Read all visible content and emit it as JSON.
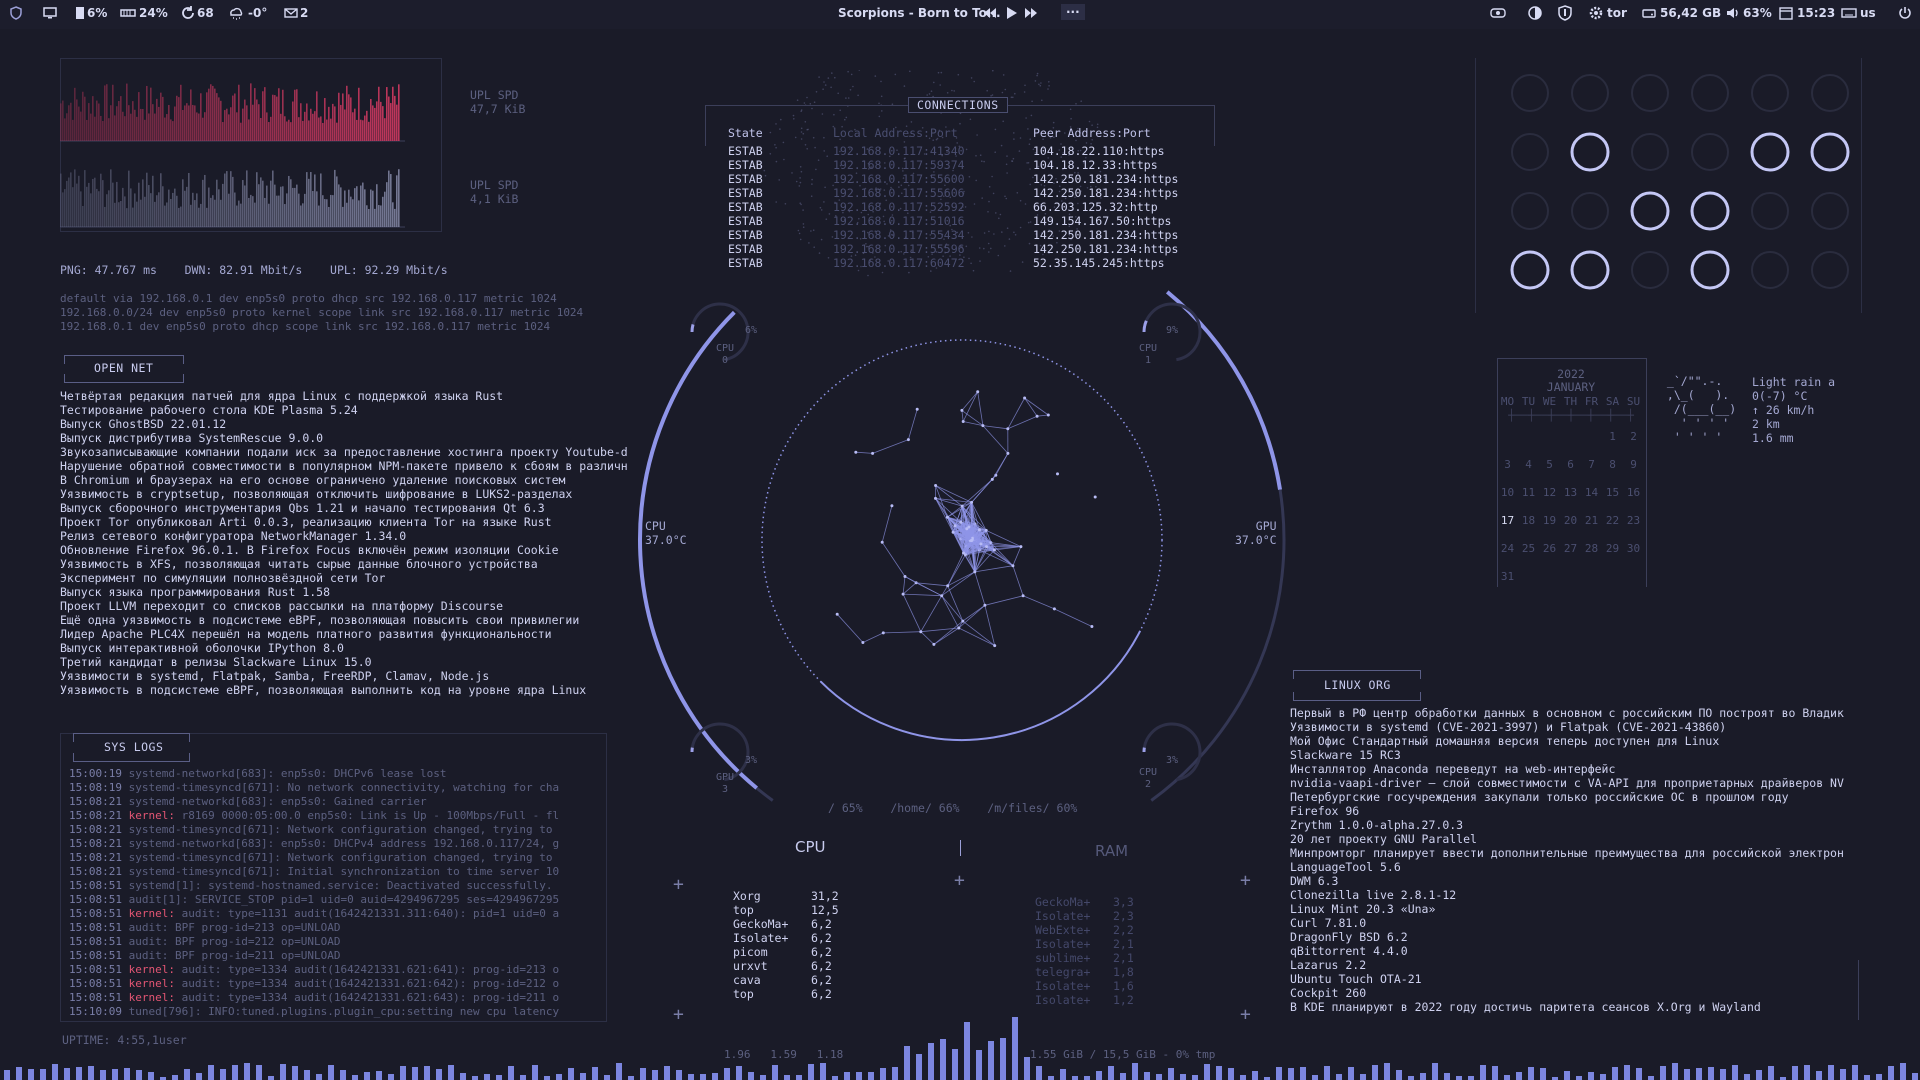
{
  "topbar": {
    "cpu": "6%",
    "mem": "24%",
    "updates": "68",
    "weather": "-0°",
    "mail": "2",
    "track": "Scorpions - Born to To...",
    "more": "···",
    "tor": "tor",
    "disk": "56,42 GB",
    "volume": "63%",
    "time": "15:23",
    "lang": "us"
  },
  "network": {
    "upl_label": "UPL SPD",
    "upl_value": "47,7 KiB",
    "dwn_label": "UPL SPD",
    "dwn_value": "4,1 KiB",
    "stats": "PNG: 47.767 ms    DWN: 82.91 Mbit/s    UPL: 92.29 Mbit/s",
    "routes": [
      "default via 192.168.0.1 dev enp5s0 proto dhcp src 192.168.0.117 metric 1024",
      "192.168.0.0/24 dev enp5s0 proto kernel scope link src 192.168.0.117 metric 1024",
      "192.168.0.1 dev enp5s0 proto dhcp scope link src 192.168.0.117 metric 1024"
    ]
  },
  "opennet": {
    "title": "OPEN NET",
    "items": [
      "Четвёртая редакция патчей для ядра Linux с поддержкой языка Rust",
      "Тестирование рабочего стола KDE Plasma 5.24",
      "Выпуск GhostBSD 22.01.12",
      "Выпуск дистрибутива SystemRescue 9.0.0",
      "Звукозаписывающие компании подали иск за предоставление хостинга проекту Youtube-d",
      "Нарушение обратной совместимости в популярном NPM-пакете привело к сбоям в различн",
      "В Chromium и браузерах на его основе ограничено удаление поисковых систем",
      "Уязвимость в cryptsetup, позволяющая отключить шифрование в LUKS2-разделах",
      "Выпуск сборочного инструментария Qbs 1.21 и начало тестирования Qt 6.3",
      "Проект Tor опубликовал Arti 0.0.3, реализацию клиента Tor на языке Rust",
      "Релиз сетевого конфигуратора NetworkManager 1.34.0",
      "Обновление Firefox 96.0.1. В Firefox Focus включён режим изоляции Cookie",
      "Уязвимость в XFS, позволяющая читать сырые данные  блочного устройства",
      "Эксперимент по симуляции полнозвёздной сети Tor",
      "Выпуск языка программирования Rust 1.58",
      "Проект LLVM переходит со списков рассылки на платформу Discourse",
      "Ещё одна уязвимость в подсистеме eBPF, позволяющая повысить свои привилегии",
      "Лидер Apache PLC4X перешёл на модель платного развития функциональности",
      "Выпуск интерактивной оболочки IPython 8.0",
      "Третий кандидат в релизы Slackware Linux 15.0",
      "Уязвимости в  systemd, Flatpak, Samba, FreeRDP, Clamav, Node.js",
      "Уязвимость в подсистеме eBPF, позволяющая выполнить код на уровне ядра Linux"
    ]
  },
  "syslogs": {
    "title": "SYS LOGS",
    "rows": [
      {
        "t": "15:00:19",
        "src": "systemd-networkd[683]:",
        "msg": " enp5s0: DHCPv6 lease lost",
        "k": false
      },
      {
        "t": "15:08:19",
        "src": "systemd-timesyncd[671]:",
        "msg": " No network connectivity, watching for cha",
        "k": false
      },
      {
        "t": "15:08:21",
        "src": "systemd-networkd[683]:",
        "msg": " enp5s0: Gained carrier",
        "k": false
      },
      {
        "t": "15:08:21",
        "src": "kernel:",
        "msg": " r8169 0000:05:00.0 enp5s0: Link is Up - 100Mbps/Full - fl",
        "k": true
      },
      {
        "t": "15:08:21",
        "src": "systemd-timesyncd[671]:",
        "msg": " Network configuration changed, trying to",
        "k": false
      },
      {
        "t": "15:08:21",
        "src": "systemd-networkd[683]:",
        "msg": " enp5s0: DHCPv4 address 192.168.0.117/24, g",
        "k": false
      },
      {
        "t": "15:08:21",
        "src": "systemd-timesyncd[671]:",
        "msg": " Network configuration changed, trying to",
        "k": false
      },
      {
        "t": "15:08:21",
        "src": "systemd-timesyncd[671]:",
        "msg": " Initial synchronization to time server 10",
        "k": false
      },
      {
        "t": "15:08:51",
        "src": "systemd[1]:",
        "msg": " systemd-hostnamed.service: Deactivated successfully.",
        "k": false
      },
      {
        "t": "15:08:51",
        "src": "audit[1]:",
        "msg": " SERVICE_STOP pid=1 uid=0 auid=4294967295 ses=4294967295",
        "k": false
      },
      {
        "t": "15:08:51",
        "src": "kernel:",
        "msg": " audit: type=1131 audit(1642421331.311:640): pid=1 uid=0 a",
        "k": true
      },
      {
        "t": "15:08:51",
        "src": "audit:",
        "msg": " BPF prog-id=213 op=UNLOAD",
        "k": false
      },
      {
        "t": "15:08:51",
        "src": "audit:",
        "msg": " BPF prog-id=212 op=UNLOAD",
        "k": false
      },
      {
        "t": "15:08:51",
        "src": "audit:",
        "msg": " BPF prog-id=211 op=UNLOAD",
        "k": false
      },
      {
        "t": "15:08:51",
        "src": "kernel:",
        "msg": " audit: type=1334 audit(1642421331.621:641): prog-id=213 o",
        "k": true
      },
      {
        "t": "15:08:51",
        "src": "kernel:",
        "msg": " audit: type=1334 audit(1642421331.621:642): prog-id=212 o",
        "k": true
      },
      {
        "t": "15:08:51",
        "src": "kernel:",
        "msg": " audit: type=1334 audit(1642421331.621:643): prog-id=211 o",
        "k": true
      },
      {
        "t": "15:10:09",
        "src": "tuned[796]:",
        "msg": " INFO:tuned.plugins.plugin_cpu:setting new cpu latency",
        "k": false
      }
    ]
  },
  "uptime": "UPTIME: 4:55,1user",
  "connections": {
    "title": "CONNECTIONS",
    "headers": [
      "State",
      "Local Address:Port",
      "Peer Address:Port"
    ],
    "rows": [
      [
        "ESTAB",
        "192.168.0.117:41340",
        "104.18.22.110:https"
      ],
      [
        "ESTAB",
        "192.168.0.117:59374",
        "104.18.12.33:https"
      ],
      [
        "ESTAB",
        "192.168.0.117:55600",
        "142.250.181.234:https"
      ],
      [
        "ESTAB",
        "192.168.0.117:55606",
        "142.250.181.234:https"
      ],
      [
        "ESTAB",
        "192.168.0.117:52592",
        "66.203.125.32:http"
      ],
      [
        "ESTAB",
        "192.168.0.117:51016",
        "149.154.167.50:https"
      ],
      [
        "ESTAB",
        "192.168.0.117:55434",
        "142.250.181.234:https"
      ],
      [
        "ESTAB",
        "192.168.0.117:55596",
        "142.250.181.234:https"
      ],
      [
        "ESTAB",
        "192.168.0.117:60472",
        "52.35.145.245:https"
      ]
    ]
  },
  "gauges": {
    "cpu0": {
      "label": "CPU",
      "num": "0",
      "pct": "6%",
      "value": 6
    },
    "cpu1": {
      "label": "CPU",
      "num": "1",
      "pct": "9%",
      "value": 9
    },
    "gpu3": {
      "label": "GPU",
      "num": "3",
      "pct": "3%",
      "value": 3
    },
    "cpu2": {
      "label": "CPU",
      "num": "2",
      "pct": "3%",
      "value": 3
    }
  },
  "temps": {
    "cpu_label": "CPU",
    "cpu_value": "37.0°C",
    "gpu_label": "GPU",
    "gpu_value": "37.0°C"
  },
  "disks": {
    "root": "/ 65%",
    "home": "/home/ 66%",
    "files": "/m/files/ 60%"
  },
  "cpu_procs": {
    "title": "CPU",
    "rows": [
      [
        "Xorg",
        "31,2"
      ],
      [
        "top",
        "12,5"
      ],
      [
        "GeckoMa+",
        "6,2"
      ],
      [
        "Isolate+",
        "6,2"
      ],
      [
        "picom",
        "6,2"
      ],
      [
        "urxvt",
        "6,2"
      ],
      [
        "cava",
        "6,2"
      ],
      [
        "top",
        "6,2"
      ]
    ]
  },
  "ram_procs": {
    "title": "RAM",
    "rows": [
      [
        "GeckoMa+",
        "3,3"
      ],
      [
        "Isolate+",
        "2,3"
      ],
      [
        "WebExte+",
        "2,2"
      ],
      [
        "Isolate+",
        "2,1"
      ],
      [
        "sublime+",
        "2,1"
      ],
      [
        "telegra+",
        "1,8"
      ],
      [
        "Isolate+",
        "1,6"
      ],
      [
        "Isolate+",
        "1,2"
      ]
    ]
  },
  "bottom": {
    "load": "1.96   1.59   1.18",
    "mem": "1.55 GiB / 15,5 GiB - 0% tmp"
  },
  "calendar": {
    "year": "2022",
    "month": "JANUARY",
    "weekdays": [
      "MO",
      "TU",
      "WE",
      "TH",
      "FR",
      "SA",
      "SU"
    ],
    "weeks": [
      [
        "",
        "",
        "",
        "",
        "",
        "1",
        "2"
      ],
      [
        "3",
        "4",
        "5",
        "6",
        "7",
        "8",
        "9"
      ],
      [
        "10",
        "11",
        "12",
        "13",
        "14",
        "15",
        "16"
      ],
      [
        "17",
        "18",
        "19",
        "20",
        "21",
        "22",
        "23"
      ],
      [
        "24",
        "25",
        "26",
        "27",
        "28",
        "29",
        "30"
      ],
      [
        "31",
        "",
        "",
        "",
        "",
        "",
        ""
      ]
    ],
    "today": "17"
  },
  "weather": {
    "art": [
      " _`/\"\".-.  ",
      " ,\\_(   ). ",
      "  /(___(__) ",
      "   ' ' ' ' ",
      "  ' ' ' '  "
    ],
    "lines": [
      "Light rain a",
      "0(-7) °C",
      "↑ 26 km/h",
      "2 km",
      "1.6 mm"
    ]
  },
  "linuxorg": {
    "title": "LINUX ORG",
    "items": [
      "Первый в РФ центр обработки данных в основном с российским ПО построят во Владик",
      "Уязвимости в systemd (CVE-2021-3997) и Flatpak (CVE-2021-43860)",
      "Мой Офис Стандартный домашняя версия теперь доступен для Linux",
      "Slackware 15 RC3",
      "Инсталлятор Anaconda переведут на web-интерфейс",
      "nvidia-vaapi-driver — слой совместимости с VA-API для проприетарных драйверов NV",
      "Петербургские госучреждения закупали только российские ОС в прошлом году",
      "Firefox 96",
      "Zrythm 1.0.0-alpha.27.0.3",
      "20 лет проекту GNU Parallel",
      "Минпромторг планирует ввести дополнительные преимущества для российской электрон",
      "LanguageTool 5.6",
      "DWM 6.3",
      "Clonezilla live 2.8.1-12",
      "Linux Mint 20.3 «Una»",
      "Curl 7.81.0",
      "DragonFly BSD 6.2",
      "qBittorrent 4.4.0",
      "Lazarus 2.2",
      "Ubuntu Touch OTA-21",
      "Cockpit 260",
      "В KDE планируют в 2022 году достичь паритета сеансов X.Org и Wayland"
    ]
  },
  "workspaces": [
    0,
    0,
    0,
    0,
    0,
    0,
    0,
    1,
    0,
    0,
    1,
    1,
    0,
    0,
    1,
    1,
    0,
    0,
    1,
    1,
    0,
    1,
    0,
    0
  ],
  "colors": {
    "accent": "#8f95e8",
    "upload": "#c8385f",
    "kernel": "#e25573",
    "bg": "#1a1b28"
  }
}
